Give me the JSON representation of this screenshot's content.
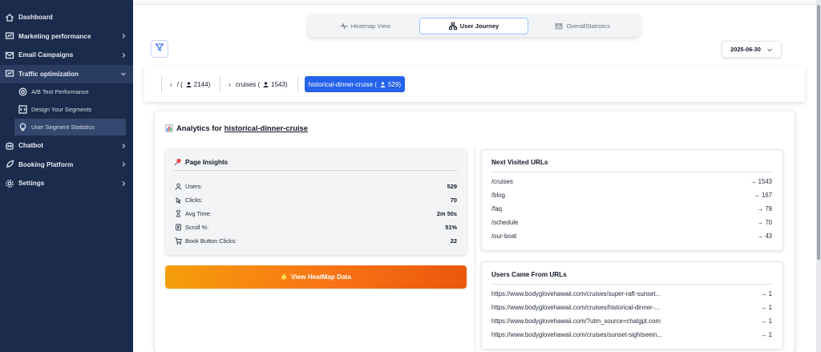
{
  "sidebar": {
    "items": [
      {
        "label": "Dashboard",
        "icon": "home-icon",
        "chevron": false
      },
      {
        "label": "Marketing performance",
        "icon": "chart-icon",
        "chevron": true
      },
      {
        "label": "Email Campaigns",
        "icon": "mail-icon",
        "chevron": true
      },
      {
        "label": "Traffic optimization",
        "icon": "traffic-icon",
        "chevron": true,
        "expanded": true
      }
    ],
    "subitems": [
      {
        "label": "A/B Test Performance",
        "icon": "target-icon"
      },
      {
        "label": "Design Your Segments",
        "icon": "code-icon"
      },
      {
        "label": "User Segment Statistics",
        "icon": "bulb-icon",
        "active": true
      }
    ],
    "items_after": [
      {
        "label": "Chatbot",
        "icon": "chatbot-icon"
      },
      {
        "label": "Booking Platform",
        "icon": "rocket-icon"
      },
      {
        "label": "Settings",
        "icon": "gear-icon"
      }
    ]
  },
  "tabs": [
    {
      "label": "Heatmap View",
      "icon": "pulse-icon"
    },
    {
      "label": "User Journey",
      "icon": "sitemap-icon",
      "active": true
    },
    {
      "label": "OverallStatistics",
      "icon": "bar-chart-icon"
    }
  ],
  "date": {
    "value": "2025-06-30"
  },
  "breadcrumb": [
    {
      "label": "/ (",
      "count": "2144)"
    },
    {
      "label": "cruises (",
      "count": "1543)"
    },
    {
      "label": "historical-dinner-cruise (",
      "count": "529)",
      "active": true
    }
  ],
  "analytics": {
    "title_prefix": "Analytics for",
    "title_link": "historical-dinner-cruise"
  },
  "insights": {
    "title": "Page Insights",
    "metrics": [
      {
        "label": "Users:",
        "value": "529",
        "icon": "user-icon"
      },
      {
        "label": "Clicks:",
        "value": "70",
        "icon": "click-icon"
      },
      {
        "label": "Avg Time:",
        "value": "2m 50s",
        "icon": "hourglass-icon"
      },
      {
        "label": "Scroll %:",
        "value": "51%",
        "icon": "scroll-icon"
      },
      {
        "label": "Book Button Clicks:",
        "value": "22",
        "icon": "cart-icon"
      }
    ]
  },
  "heatmap_button": {
    "label": "View HeatMap Data",
    "icon": "fire-icon"
  },
  "next_urls": {
    "title": "Next Visited URLs",
    "rows": [
      {
        "url": "/cruises",
        "count": "→ 1543"
      },
      {
        "url": "/blog",
        "count": "→ 167"
      },
      {
        "url": "/faq",
        "count": "→ 79"
      },
      {
        "url": "/schedule",
        "count": "→ 70"
      },
      {
        "url": "/our-boat",
        "count": "→ 43"
      }
    ]
  },
  "came_from": {
    "title": "Users Came From URLs",
    "rows": [
      {
        "url": "https://www.bodyglovehawaii.com/cruises/super-raft-sunset...",
        "count": "→ 1"
      },
      {
        "url": "https://www.bodyglovehawaii.com/cruises/historical-dinner-...",
        "count": "→ 1"
      },
      {
        "url": "https://www.bodyglovehawaii.com/?utm_source=chatgpt.com",
        "count": "→ 1"
      },
      {
        "url": "https://www.bodyglovehawaii.com/cruises/sunset-sightseein...",
        "count": "→ 1"
      }
    ]
  },
  "colors": {
    "sidebar_bg": "#1b2b4b",
    "accent": "#2563eb",
    "button_gradient_start": "#f59e0b",
    "button_gradient_end": "#ea580c"
  }
}
